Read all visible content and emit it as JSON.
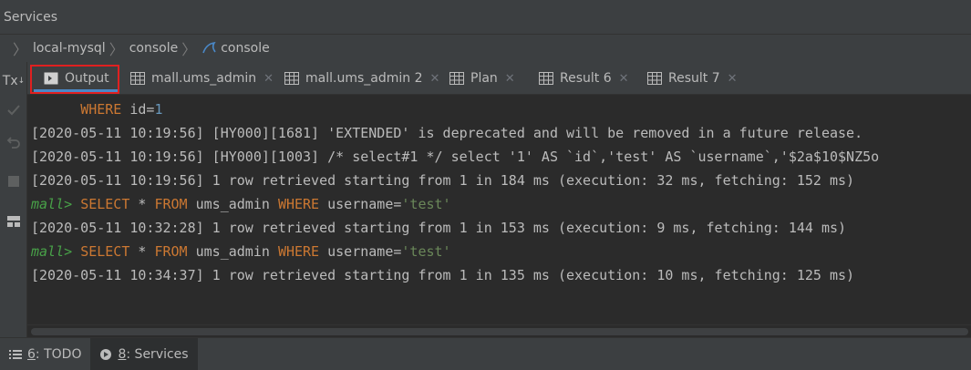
{
  "window": {
    "title": "Services"
  },
  "breadcrumb": {
    "items": [
      "local-mysql",
      "console",
      "console"
    ]
  },
  "left_toolbar": {
    "tx_label": "Tx"
  },
  "tabs": [
    {
      "label": "Output",
      "icon": "console-output-icon",
      "active": true
    },
    {
      "label": "mall.ums_admin",
      "icon": "table-grid-icon"
    },
    {
      "label": "mall.ums_admin 2",
      "icon": "table-grid-icon"
    },
    {
      "label": "Plan",
      "icon": "table-grid-icon"
    },
    {
      "label": "Result 6",
      "icon": "table-grid-icon"
    },
    {
      "label": "Result 7",
      "icon": "table-grid-icon"
    }
  ],
  "console": {
    "line0": {
      "kw": "WHERE",
      "text": " id=",
      "num": "1"
    },
    "line1": "[2020-05-11 10:19:56] [HY000][1681] 'EXTENDED' is deprecated and will be removed in a future release.",
    "line2": "[2020-05-11 10:19:56] [HY000][1003] /* select#1 */ select '1' AS `id`,'test' AS `username`,'$2a$10$NZ5o",
    "line3": "[2020-05-11 10:19:56] 1 row retrieved starting from 1 in 184 ms (execution: 32 ms, fetching: 152 ms)",
    "query1": {
      "prompt": "mall>",
      "select": "SELECT",
      "star": " * ",
      "from": "FROM",
      "table": " ums_admin ",
      "where": "WHERE",
      "cond": " username=",
      "value": "'test'"
    },
    "line5": "[2020-05-11 10:32:28] 1 row retrieved starting from 1 in 153 ms (execution: 9 ms, fetching: 144 ms)",
    "query2": {
      "prompt": "mall>",
      "select": "SELECT",
      "star": " * ",
      "from": "FROM",
      "table": " ums_admin ",
      "where": "WHERE",
      "cond": " username=",
      "value": "'test'"
    },
    "line7": "[2020-05-11 10:34:37] 1 row retrieved starting from 1 in 135 ms (execution: 10 ms, fetching: 125 ms)"
  },
  "bottom_bar": {
    "todo": {
      "num": "6",
      "label": ": TODO"
    },
    "services": {
      "num": "8",
      "label": ": Services"
    }
  },
  "colors": {
    "keyword": "#cc7832",
    "number": "#6897bb",
    "string": "#6a8759",
    "prompt": "#48a148",
    "highlight_box": "#e02020",
    "tab_underline": "#4a88c7"
  }
}
